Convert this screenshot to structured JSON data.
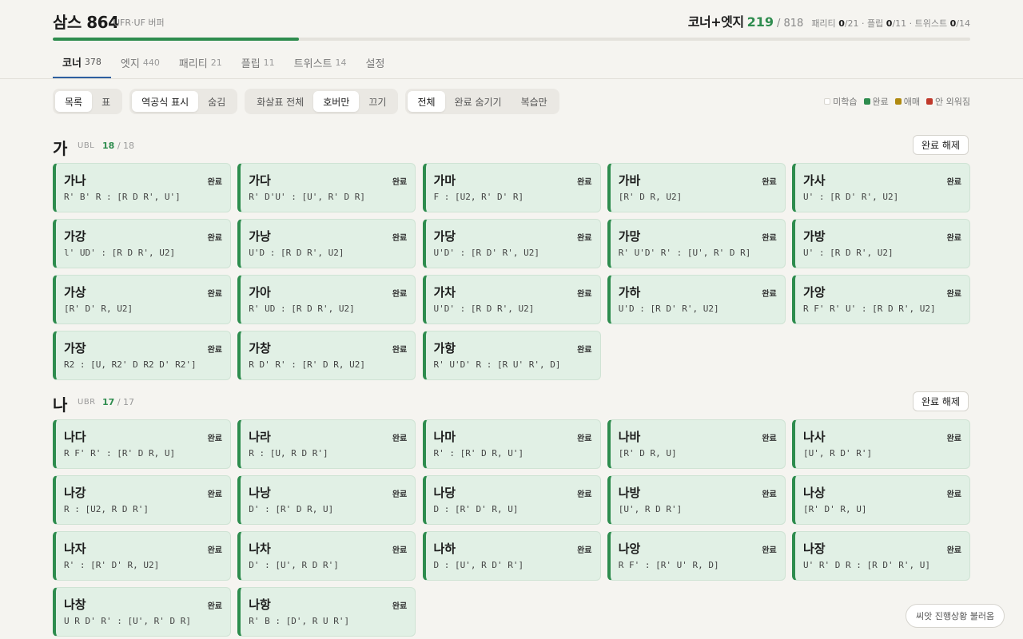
{
  "header": {
    "title": "삼스 864",
    "subtitle": "UFR·UF 버퍼",
    "right_label": "코너+엣지",
    "right_count": "219",
    "right_total": "/ 818",
    "stats": [
      {
        "label": "패리티",
        "value": "0",
        "total": "/21"
      },
      {
        "label": "플립",
        "value": "0",
        "total": "/11"
      },
      {
        "label": "트위스트",
        "value": "0",
        "total": "/14"
      }
    ],
    "progress_fraction": 0.268
  },
  "tabs": [
    {
      "label": "코너",
      "count": "378"
    },
    {
      "label": "엣지",
      "count": "440"
    },
    {
      "label": "패리티",
      "count": "21"
    },
    {
      "label": "플립",
      "count": "11"
    },
    {
      "label": "트위스트",
      "count": "14"
    },
    {
      "label": "설정",
      "count": ""
    }
  ],
  "toolbar": [
    {
      "options": [
        "목록",
        "표"
      ],
      "active": 0
    },
    {
      "options": [
        "역공식 표시",
        "숨김"
      ],
      "active": 0
    },
    {
      "options": [
        "화살표 전체",
        "호버만",
        "끄기"
      ],
      "active": 1
    },
    {
      "options": [
        "전체",
        "완료 숨기기",
        "복습만"
      ],
      "active": 0
    }
  ],
  "legend": [
    {
      "label": "미학습",
      "color": "#ffffff",
      "border": "#d8d6d0"
    },
    {
      "label": "완료",
      "color": "#2e8c4e",
      "border": "#2e8c4e"
    },
    {
      "label": "애매",
      "color": "#b08a10",
      "border": "#b08a10"
    },
    {
      "label": "안 외워짐",
      "color": "#c0392b",
      "border": "#c0392b"
    }
  ],
  "sections": [
    {
      "letter": "가",
      "code": "UBL",
      "done": "18",
      "total": "/ 18",
      "button": "완료 해제",
      "cards": [
        {
          "name": "가나",
          "status": "완료",
          "alg": "R' B' R : [R D R', U']"
        },
        {
          "name": "가다",
          "status": "완료",
          "alg": "R' D'U' : [U', R' D R]"
        },
        {
          "name": "가마",
          "status": "완료",
          "alg": "F : [U2, R' D' R]"
        },
        {
          "name": "가바",
          "status": "완료",
          "alg": "[R' D R, U2]"
        },
        {
          "name": "가사",
          "status": "완료",
          "alg": "U' : [R D' R', U2]"
        },
        {
          "name": "가강",
          "status": "완료",
          "alg": "l' UD' : [R D R', U2]"
        },
        {
          "name": "가낭",
          "status": "완료",
          "alg": "U'D : [R D R', U2]"
        },
        {
          "name": "가당",
          "status": "완료",
          "alg": "U'D' : [R D' R', U2]"
        },
        {
          "name": "가망",
          "status": "완료",
          "alg": "R' U'D' R' : [U', R' D R]"
        },
        {
          "name": "가방",
          "status": "완료",
          "alg": "U' : [R D R', U2]"
        },
        {
          "name": "가상",
          "status": "완료",
          "alg": "[R' D' R, U2]"
        },
        {
          "name": "가아",
          "status": "완료",
          "alg": "R' UD : [R D R', U2]"
        },
        {
          "name": "가차",
          "status": "완료",
          "alg": "U'D' : [R D R', U2]"
        },
        {
          "name": "가하",
          "status": "완료",
          "alg": "U'D : [R D' R', U2]"
        },
        {
          "name": "가앙",
          "status": "완료",
          "alg": "R F' R' U' : [R D R', U2]"
        },
        {
          "name": "가장",
          "status": "완료",
          "alg": "R2 : [U, R2' D R2 D' R2']"
        },
        {
          "name": "가창",
          "status": "완료",
          "alg": "R D' R' : [R' D R, U2]"
        },
        {
          "name": "가항",
          "status": "완료",
          "alg": "R' U'D' R : [R U' R', D]"
        }
      ]
    },
    {
      "letter": "나",
      "code": "UBR",
      "done": "17",
      "total": "/ 17",
      "button": "완료 해제",
      "cards": [
        {
          "name": "나다",
          "status": "완료",
          "alg": "R F' R' : [R' D R, U]"
        },
        {
          "name": "나라",
          "status": "완료",
          "alg": "R : [U, R D R']"
        },
        {
          "name": "나마",
          "status": "완료",
          "alg": "R' : [R' D R, U']"
        },
        {
          "name": "나바",
          "status": "완료",
          "alg": "[R' D R, U]"
        },
        {
          "name": "나사",
          "status": "완료",
          "alg": "[U', R D' R']"
        },
        {
          "name": "나강",
          "status": "완료",
          "alg": "R : [U2, R D R']"
        },
        {
          "name": "나낭",
          "status": "완료",
          "alg": "D' : [R' D R, U]"
        },
        {
          "name": "나당",
          "status": "완료",
          "alg": "D : [R' D' R, U]"
        },
        {
          "name": "나방",
          "status": "완료",
          "alg": "[U', R D R']"
        },
        {
          "name": "나상",
          "status": "완료",
          "alg": "[R' D' R, U]"
        },
        {
          "name": "나자",
          "status": "완료",
          "alg": "R' : [R' D' R, U2]"
        },
        {
          "name": "나차",
          "status": "완료",
          "alg": "D' : [U', R D R']"
        },
        {
          "name": "나하",
          "status": "완료",
          "alg": "D : [U', R D' R']"
        },
        {
          "name": "나앙",
          "status": "완료",
          "alg": "R F' : [R' U' R, D]"
        },
        {
          "name": "나장",
          "status": "완료",
          "alg": "U' R' D R : [R D' R', U]"
        },
        {
          "name": "나창",
          "status": "완료",
          "alg": "U R D' R' : [U', R' D R]"
        },
        {
          "name": "나항",
          "status": "완료",
          "alg": "R' B : [D', R U R']"
        }
      ]
    }
  ],
  "float_button": "씨앗 진행상황 불러옴"
}
